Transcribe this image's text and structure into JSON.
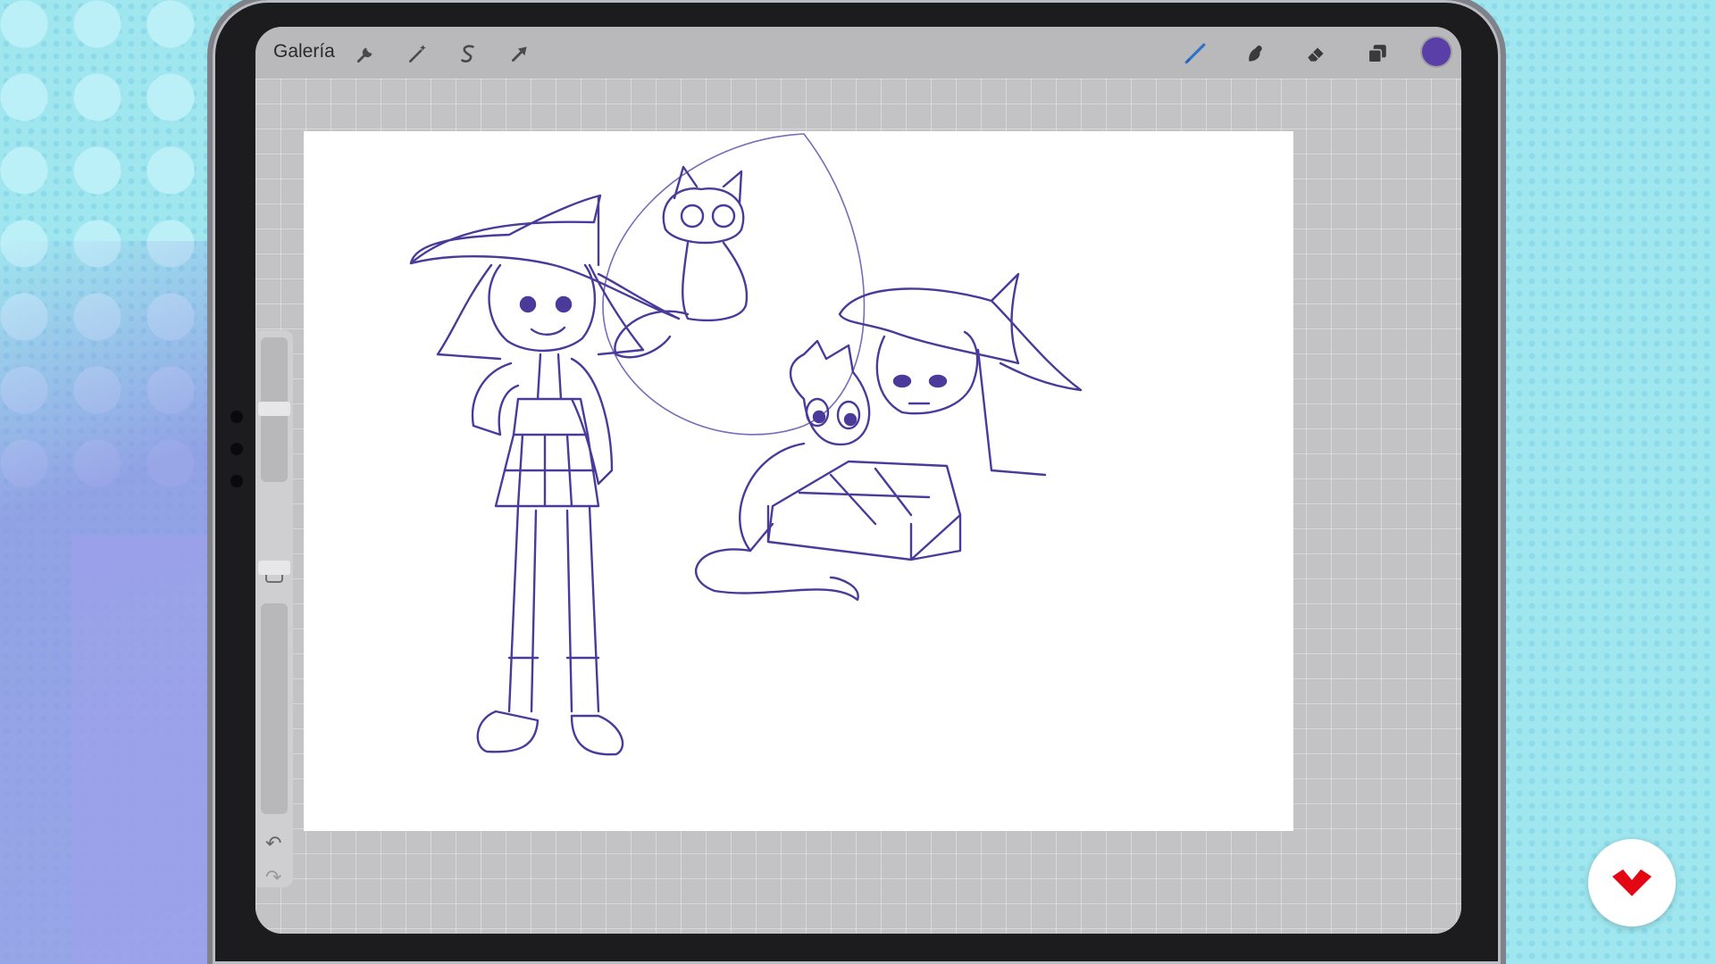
{
  "toolbar": {
    "gallery_label": "Galería",
    "left_tools": [
      {
        "name": "actions",
        "icon": "wrench-icon"
      },
      {
        "name": "adjustments",
        "icon": "magic-wand-icon"
      },
      {
        "name": "selection",
        "icon": "selection-s-icon"
      },
      {
        "name": "transform",
        "icon": "arrow-cursor-icon"
      }
    ],
    "right_tools": [
      {
        "name": "brush",
        "icon": "brush-icon",
        "active": true
      },
      {
        "name": "smudge",
        "icon": "smudge-finger-icon"
      },
      {
        "name": "eraser",
        "icon": "eraser-icon"
      },
      {
        "name": "layers",
        "icon": "layers-icon"
      }
    ],
    "current_color": "#5b3fa8"
  },
  "sidebar": {
    "brush_size_level": 0.85,
    "opacity_level": 0.95,
    "undo_icon": "undo-arrow-icon",
    "redo_icon": "redo-arrow-icon"
  },
  "canvas": {
    "content": "sketch-drawing",
    "stroke_color": "#4b3a9a"
  },
  "watermark": {
    "icon": "domestika-logo-icon",
    "color": "#e30613"
  }
}
